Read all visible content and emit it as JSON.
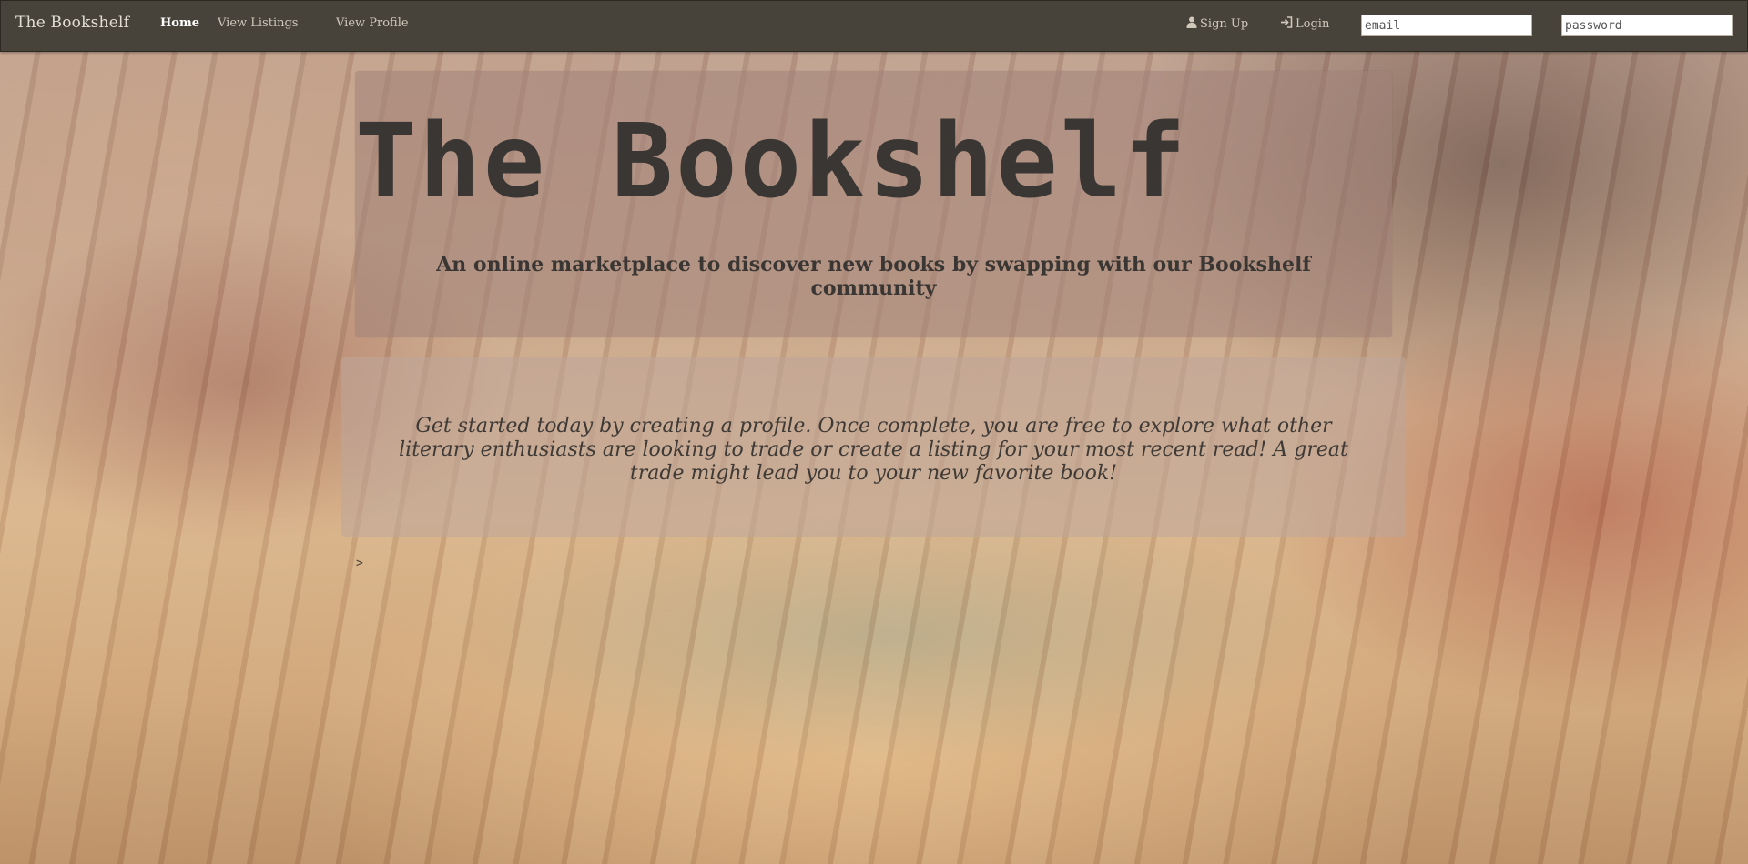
{
  "navbar": {
    "brand": "The Bookshelf",
    "links": {
      "home": "Home",
      "listings": "View Listings",
      "profile": "View Profile",
      "signup": "Sign Up",
      "login": "Login"
    },
    "email_placeholder": "email",
    "password_placeholder": "password",
    "icons": {
      "signup": "user-icon",
      "login": "log-in-icon"
    },
    "bg_color": "#47423a"
  },
  "hero": {
    "title": "The Bookshelf",
    "subtitle": "An online marketplace to discover new books by swapping with our Bookshelf community"
  },
  "intro": {
    "text": "Get started today by creating a profile. Once complete, you are free to explore what other literary enthusiasts are looking to trade or create a listing for your most recent read! A great trade might lead you to your new favorite book!"
  },
  "stray_text": ">"
}
